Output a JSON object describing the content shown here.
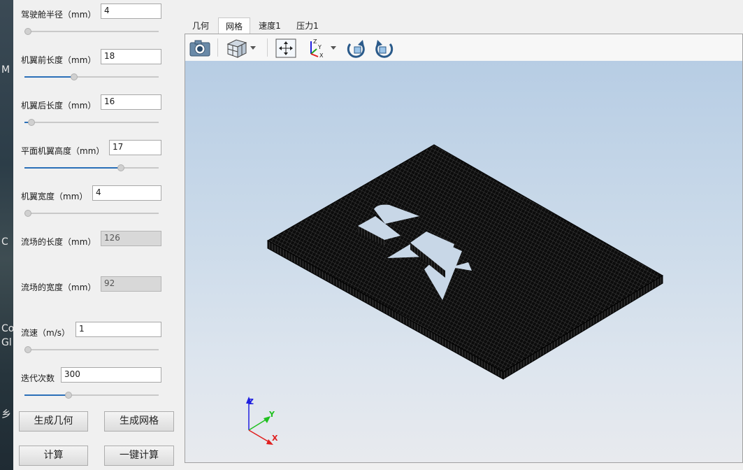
{
  "desktop": {
    "fragments": [
      "M",
      "C",
      "Co",
      "Gl",
      "乡"
    ]
  },
  "params": [
    {
      "label": "驾驶舱半径（mm）",
      "value": "4",
      "readonly": false,
      "slider": 0
    },
    {
      "label": "机翼前长度（mm）",
      "value": "18",
      "readonly": false,
      "slider": 0.37
    },
    {
      "label": "机翼后长度（mm）",
      "value": "16",
      "readonly": false,
      "slider": 0.05
    },
    {
      "label": "平面机翼高度（mm）",
      "value": "17",
      "readonly": false,
      "slider": 0.72
    },
    {
      "label": "机翼宽度（mm）",
      "value": "4",
      "readonly": false,
      "slider": 0
    },
    {
      "label": "流场的长度（mm）",
      "value": "126",
      "readonly": true,
      "slider": null
    },
    {
      "label": "流场的宽度（mm）",
      "value": "92",
      "readonly": true,
      "slider": null
    },
    {
      "label": "流速（m/s）",
      "value": "1",
      "readonly": false,
      "slider": 0
    },
    {
      "label": "迭代次数",
      "value": "300",
      "readonly": false,
      "slider": 0.33
    }
  ],
  "buttons": {
    "gen_geometry": "生成几何",
    "gen_mesh": "生成网格",
    "compute": "计算",
    "one_click": "一键计算"
  },
  "tabs": [
    "几何",
    "网格",
    "速度1",
    "压力1"
  ],
  "active_tab": "网格",
  "toolbar": [
    "camera-icon",
    "cube-view-icon",
    "fit-all-icon",
    "axes-icon",
    "rotate-cw-icon",
    "rotate-ccw-icon"
  ],
  "axes": {
    "z": "Z",
    "y": "Y",
    "x": "X"
  },
  "colors": {
    "accent": "#2a6fb8",
    "axis_x": "#e02020",
    "axis_y": "#20c020",
    "axis_z": "#2020e0"
  }
}
